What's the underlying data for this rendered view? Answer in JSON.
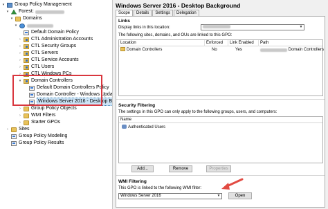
{
  "tree": {
    "root": "Group Policy Management",
    "forest_prefix": "Forest:",
    "domains": "Domains",
    "items": [
      "Default Domain Policy",
      "CTL Administration Accounts",
      "CTL Security Groups",
      "CTL Servers",
      "CTL Service Accounts",
      "CTL Users",
      "CTL Windows PCs",
      "Domain Controllers",
      "Default Domain Controllers Policy",
      "Domain Controller - Windows Update",
      "Windows Server 2016 - Desktop Backgro",
      "Group Policy Objects",
      "WMI Filters",
      "Starter GPOs",
      "Sites",
      "Group Policy Modeling",
      "Group Policy Results"
    ]
  },
  "detail": {
    "title": "Windows Server 2016 - Desktop Background",
    "tabs": [
      "Scope",
      "Details",
      "Settings",
      "Delegation"
    ],
    "links": {
      "heading": "Links",
      "display_label": "Display links in this location:",
      "description": "The following sites, domains, and OUs are linked to this GPO:",
      "columns": [
        "Location",
        "Enforced",
        "Link Enabled",
        "Path"
      ],
      "rows": [
        {
          "location": "Domain Controllers",
          "enforced": "No",
          "link_enabled": "Yes",
          "path": "Domain Controllers"
        }
      ]
    },
    "security": {
      "heading": "Security Filtering",
      "description": "The settings in this GPO can only apply to the following groups, users, and computers:",
      "column": "Name",
      "items": [
        "Authenticated Users"
      ],
      "buttons": {
        "add": "Add...",
        "remove": "Remove",
        "properties": "Properties"
      }
    },
    "wmi": {
      "heading": "WMI Filtering",
      "description": "This GPO is linked to the following WMI filter:",
      "selected": "Windows Server 2016",
      "open_button": "Open"
    }
  },
  "colors": {
    "highlight_box": "#d9363e",
    "arrow": "#e24b43",
    "selection": "#cce4f7"
  }
}
